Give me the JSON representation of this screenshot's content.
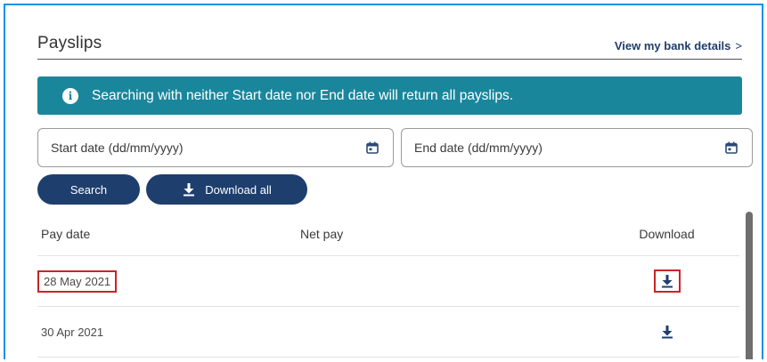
{
  "header": {
    "title": "Payslips",
    "bank_link": "View my bank details",
    "bank_link_chevron": ">"
  },
  "info_banner": {
    "icon": "info-icon",
    "text": "Searching with neither Start date nor End date will return all payslips."
  },
  "filters": {
    "start_date_placeholder": "Start date (dd/mm/yyyy)",
    "end_date_placeholder": "End date (dd/mm/yyyy)"
  },
  "buttons": {
    "search": "Search",
    "download_all": "Download all"
  },
  "table": {
    "columns": [
      "Pay date",
      "Net pay",
      "Download"
    ],
    "rows": [
      {
        "pay_date": "28 May 2021",
        "net_pay": "",
        "highlighted": true
      },
      {
        "pay_date": "30 Apr 2021",
        "net_pay": "",
        "highlighted": false
      }
    ]
  },
  "colors": {
    "frame_border": "#1a8fe3",
    "banner_bg": "#1a869b",
    "button_bg": "#1e3f6e",
    "link_color": "#1f3d6b",
    "highlight_box": "#c8242b"
  }
}
